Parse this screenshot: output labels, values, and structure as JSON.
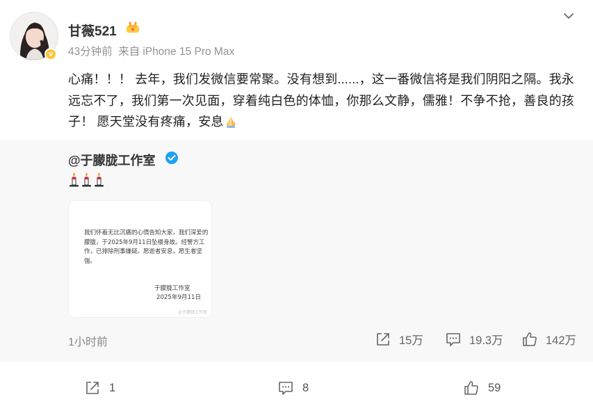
{
  "post": {
    "author": "甘薇521",
    "time": "43分钟前",
    "source": "来自 iPhone 15 Pro Max",
    "content": "心痛！！！ 去年，我们发微信要常聚。没有想到......，这一番微信将是我们阴阳之隔。我永远忘不了，我们第一次见面，穿着纯白色的体恤，你那么文静，儒雅！不争不抢，善良的孩子！ 愿天堂没有疼痛，安息"
  },
  "repost": {
    "author": "@于朦胧工作室",
    "image_text": {
      "body": "我们怀着无比沉痛的心情告知大家，我们深爱的朦胧，于2025年9月11日坠楼身故。经警方工作，已排除刑事嫌疑。愿逝者安息，愿生者坚强。",
      "signature": "于朦胧工作室",
      "date": "2025年9月11日",
      "watermark": "@于朦胧工作室"
    },
    "time": "1小时前",
    "reposts": "15万",
    "comments": "19.3万",
    "likes": "142万"
  },
  "actions": {
    "reposts": "1",
    "comments": "8",
    "likes": "59"
  },
  "icons": {
    "badge": "orange-v-badge-icon",
    "member": "crown-icon",
    "more": "chevron-down-icon",
    "verified": "blue-verified-icon",
    "emoji": "praying-hands-icon",
    "candle": "candle-icon",
    "repost": "repost-icon",
    "comment": "comment-icon",
    "like": "thumbs-up-icon"
  },
  "colors": {
    "verified_blue": "#1da1f2",
    "badge_orange": "#ffc33a",
    "repost_bg": "#f8f8f8"
  }
}
